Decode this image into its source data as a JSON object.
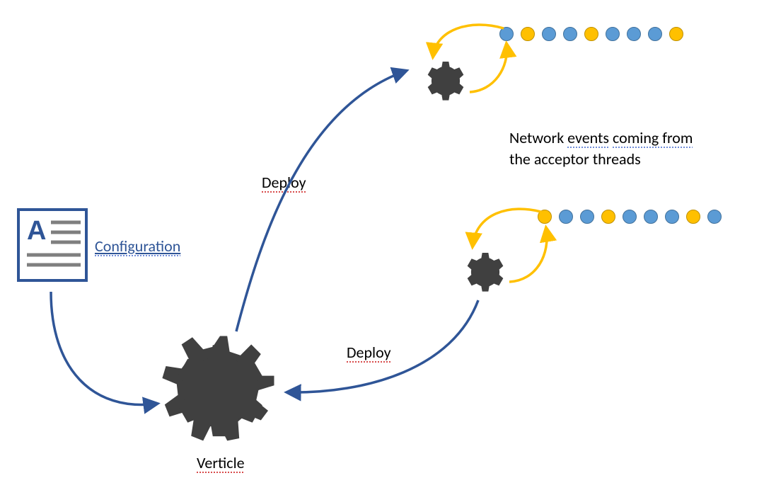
{
  "labels": {
    "configuration": "Configuration",
    "deploy_top": "Deploy",
    "deploy_bottom": "Deploy",
    "verticle": "Verticle",
    "network_line1": "Network events coming from",
    "network_line2": "the acceptor threads",
    "events_word": "events",
    "coming_from_word": "coming from"
  },
  "colors": {
    "gear": "#404040",
    "arrow_blue": "#2F5597",
    "arrow_orange": "#FFC000",
    "dot_blue": "#5B9BD5",
    "dot_orange": "#FFC000",
    "doc_border": "#2F5597",
    "doc_a": "#2F5597",
    "doc_line": "#7F7F7F"
  },
  "event_queues": {
    "top": [
      "blue",
      "orange",
      "blue",
      "blue",
      "orange",
      "blue",
      "blue",
      "blue",
      "orange"
    ],
    "bottom": [
      "orange",
      "blue",
      "blue",
      "orange",
      "blue",
      "blue",
      "blue",
      "orange",
      "blue"
    ]
  }
}
